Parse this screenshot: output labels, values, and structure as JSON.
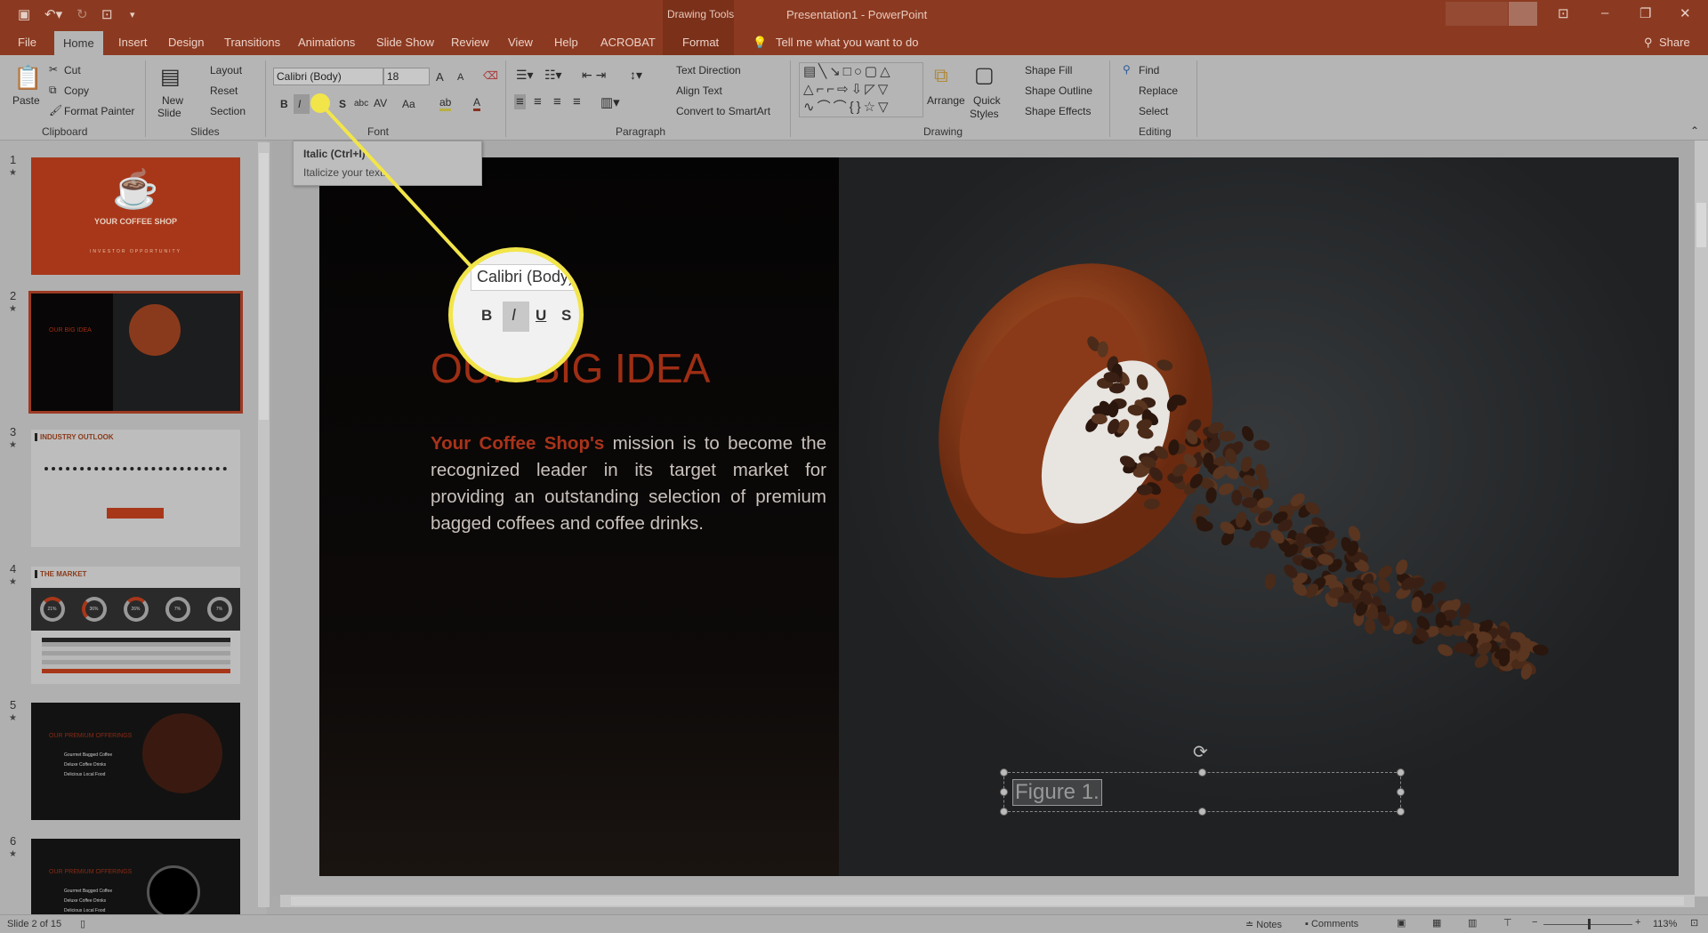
{
  "titlebar": {
    "contextual_tab_group": "Drawing Tools",
    "title": "Presentation1  -  PowerPoint",
    "minimize": "–",
    "restore": "❐",
    "close": "✕",
    "ribbon_options": "⊡"
  },
  "tabs": [
    {
      "label": "File"
    },
    {
      "label": "Home",
      "active": true
    },
    {
      "label": "Insert"
    },
    {
      "label": "Design"
    },
    {
      "label": "Transitions"
    },
    {
      "label": "Animations"
    },
    {
      "label": "Slide Show"
    },
    {
      "label": "Review"
    },
    {
      "label": "View"
    },
    {
      "label": "Help"
    },
    {
      "label": "ACROBAT"
    },
    {
      "label": "Format"
    }
  ],
  "tell_me": "Tell me what you want to do",
  "share": "Share",
  "ribbon": {
    "clipboard": {
      "paste": "Paste",
      "cut": "Cut",
      "copy": "Copy",
      "format_painter": "Format Painter",
      "group": "Clipboard"
    },
    "slides": {
      "new_slide_1": "New",
      "new_slide_2": "Slide",
      "layout": "Layout",
      "reset": "Reset",
      "section": "Section",
      "group": "Slides"
    },
    "font": {
      "font_name": "Calibri (Body)",
      "font_size": "18",
      "bold": "B",
      "italic": "I",
      "underline": "U",
      "shadow": "S",
      "strike": "abc",
      "spacing": "AV",
      "case": "Aa",
      "color": "A",
      "grow": "A",
      "shrink": "A",
      "group": "Font"
    },
    "paragraph": {
      "text_direction": "Text Direction",
      "align_text": "Align Text",
      "convert_smartart": "Convert to SmartArt",
      "group": "Paragraph"
    },
    "drawing": {
      "arrange": "Arrange",
      "quick_styles_1": "Quick",
      "quick_styles_2": "Styles",
      "shape_fill": "Shape Fill",
      "shape_outline": "Shape Outline",
      "shape_effects": "Shape Effects",
      "group": "Drawing"
    },
    "editing": {
      "find": "Find",
      "replace": "Replace",
      "select": "Select",
      "group": "Editing"
    }
  },
  "tooltip": {
    "title": "Italic (Ctrl+I)",
    "description": "Italicize your text."
  },
  "magnifier": {
    "font_name": "Calibri (Body)",
    "bold": "B",
    "italic": "I",
    "underline": "U",
    "shadow": "S"
  },
  "thumbnails": [
    {
      "number": "1",
      "title": "YOUR COFFEE SHOP",
      "subtitle": "INVESTOR OPPORTUNITY"
    },
    {
      "number": "2",
      "title": "OUR BIG IDEA",
      "selected": true
    },
    {
      "number": "3",
      "title": "INDUSTRY OUTLOOK"
    },
    {
      "number": "4",
      "title": "THE MARKET",
      "donuts": [
        "21%",
        "36%",
        "26%",
        "7%",
        "7%"
      ]
    },
    {
      "number": "5",
      "title": "OUR PREMIUM OFFERINGS",
      "items": [
        "Gourmet Bagged Coffee",
        "Deluxe Coffee Drinks",
        "Delicious Local Food"
      ]
    },
    {
      "number": "6",
      "title": "OUR PREMIUM OFFERINGS",
      "items": [
        "Gourmet Bagged Coffee",
        "Deluxe Coffee Drinks",
        "Delicious Local Food"
      ]
    }
  ],
  "slide": {
    "title": "OUR BIG IDEA",
    "body_highlight": "Your Coffee Shop's",
    "body_rest": " mission is to become the recognized leader in its target market for providing an outstanding selection of premium bagged coffees and coffee drinks.",
    "caption": "Figure 1."
  },
  "status": {
    "slide_info": "Slide 2 of 15",
    "notes": "Notes",
    "comments": "Comments",
    "zoom": "113%"
  },
  "colors": {
    "accent": "#8b3a21",
    "highlight": "#f2e54a",
    "slide_title": "#9e2e14"
  }
}
